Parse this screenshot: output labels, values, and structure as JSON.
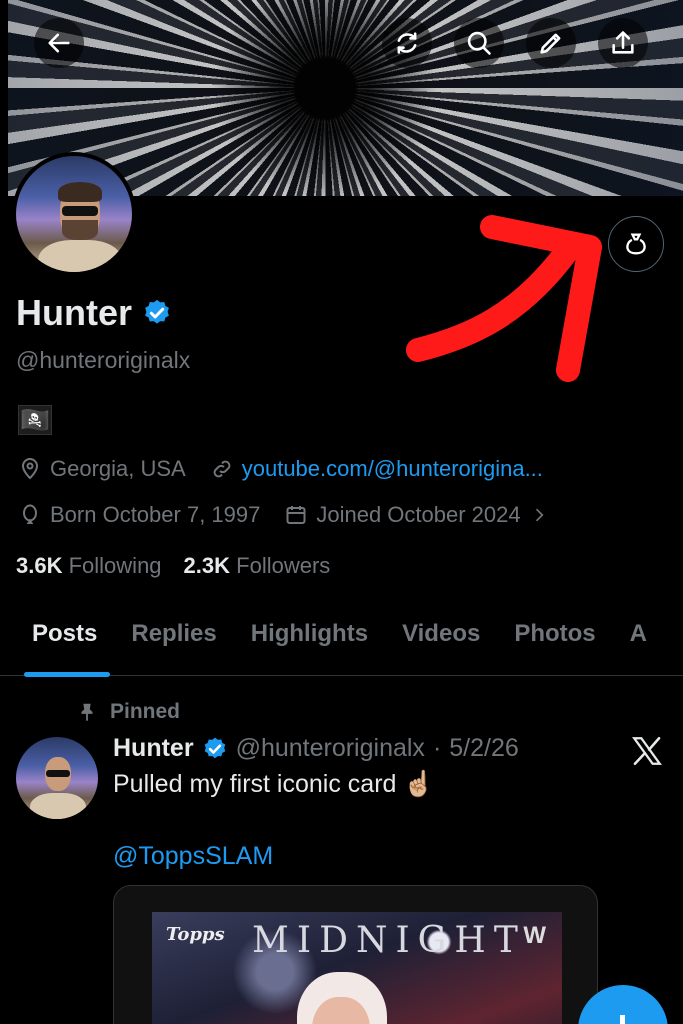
{
  "header": {
    "back_icon": "arrow-left-icon",
    "actions": [
      "refresh-icon",
      "search-icon",
      "pencil-icon",
      "share-icon"
    ]
  },
  "profile": {
    "name": "Hunter",
    "handle": "@hunteroriginalx",
    "bio_emoji": "🏴‍☠️",
    "location": "Georgia, USA",
    "website": "youtube.com/@hunterorigina...",
    "born": "Born October 7, 1997",
    "joined": "Joined October 2024",
    "following_count": "3.6K",
    "following_label": "Following",
    "followers_count": "2.3K",
    "followers_label": "Followers"
  },
  "tabs": [
    "Posts",
    "Replies",
    "Highlights",
    "Videos",
    "Photos",
    "A"
  ],
  "active_tab": "Posts",
  "pinned_post": {
    "pinned_label": "Pinned",
    "name": "Hunter",
    "handle": "@hunteroriginalx",
    "separator": "·",
    "date": "5/2/26",
    "text": "Pulled my first iconic card ☝🏼",
    "mention": "@ToppsSLAM",
    "card": {
      "brand": "Topps",
      "title": "MIDNIGHT",
      "logo": "W"
    }
  },
  "colors": {
    "accent": "#1d9bf0",
    "muted": "#71767b",
    "annotation_arrow": "#ff1a1a"
  }
}
